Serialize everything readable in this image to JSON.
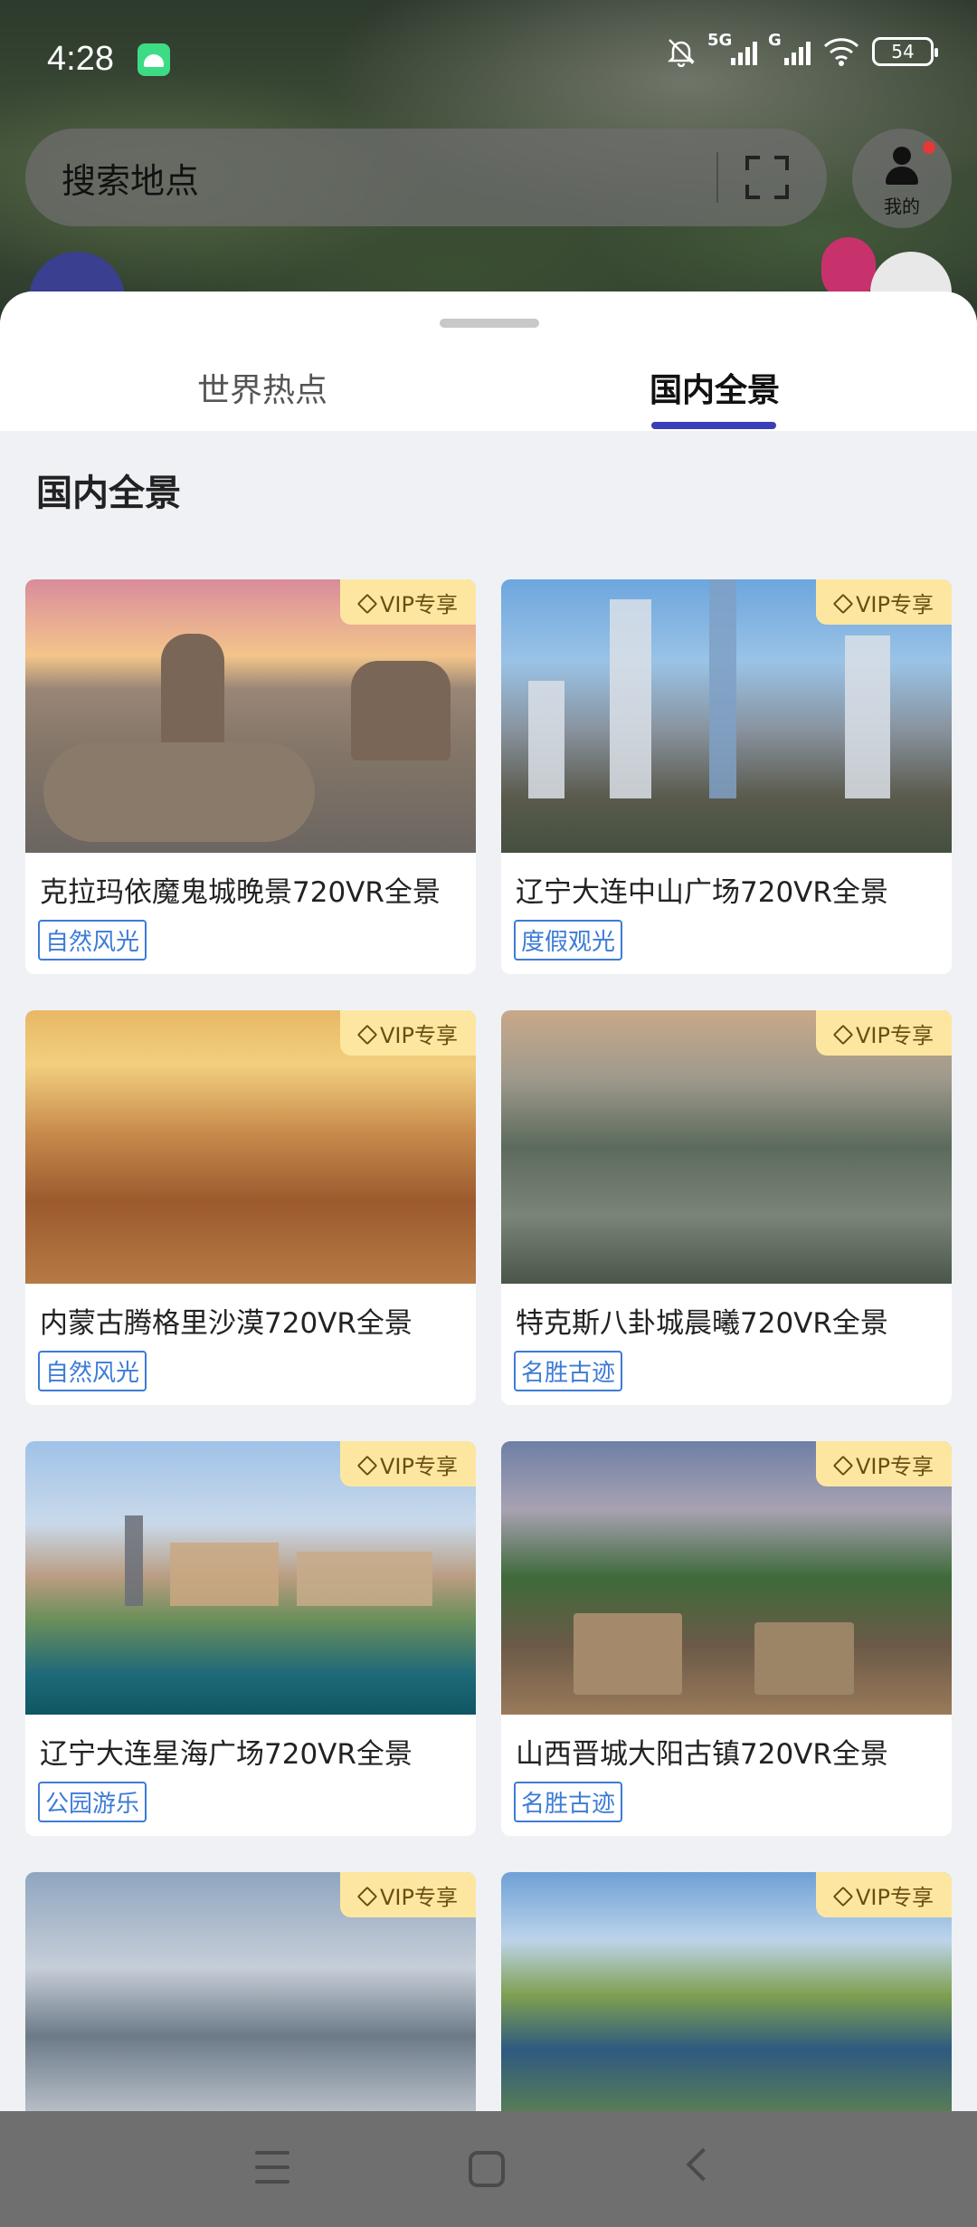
{
  "status": {
    "time": "4:28",
    "battery": "54",
    "signal1_label": "5G",
    "signal2_label": "G"
  },
  "search": {
    "placeholder": "搜索地点"
  },
  "profile": {
    "label": "我的"
  },
  "tabs": [
    {
      "label": "世界热点",
      "active": false
    },
    {
      "label": "国内全景",
      "active": true
    }
  ],
  "section": {
    "title": "国内全景"
  },
  "vip_label": "VIP专享",
  "cards": [
    {
      "title": "克拉玛依魔鬼城晚景720VR全景",
      "tag": "自然风光"
    },
    {
      "title": "辽宁大连中山广场720VR全景",
      "tag": "度假观光"
    },
    {
      "title": "内蒙古腾格里沙漠720VR全景",
      "tag": "自然风光"
    },
    {
      "title": "特克斯八卦城晨曦720VR全景",
      "tag": "名胜古迹"
    },
    {
      "title": "辽宁大连星海广场720VR全景",
      "tag": "公园游乐"
    },
    {
      "title": "山西晋城大阳古镇720VR全景",
      "tag": "名胜古迹"
    },
    {
      "title": "",
      "tag": ""
    },
    {
      "title": "",
      "tag": ""
    }
  ],
  "colors": {
    "accent": "#3b3fb7",
    "tag": "#3c7bd6",
    "vip_bg": "#fde7a0"
  }
}
